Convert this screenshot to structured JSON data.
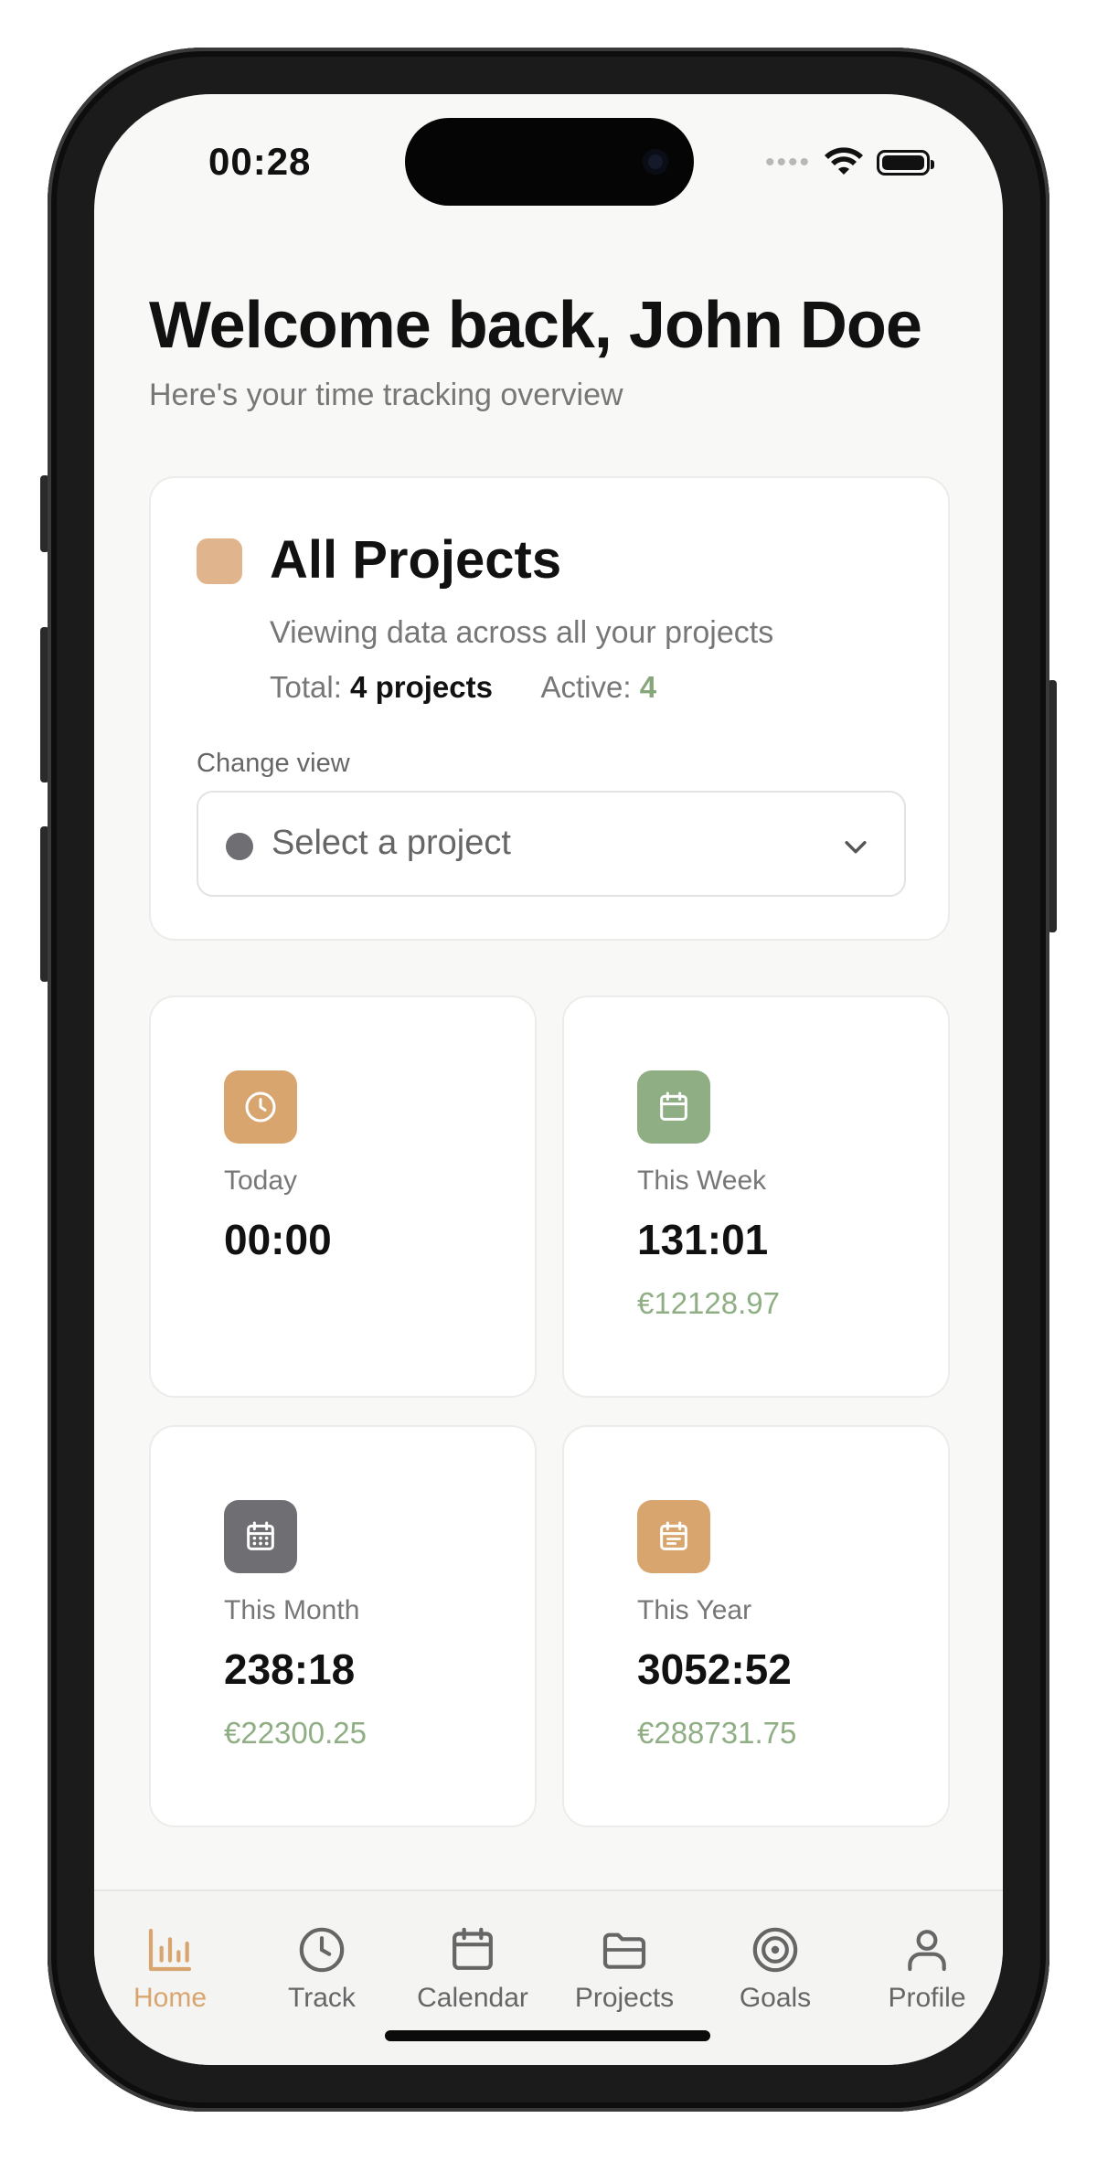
{
  "status_bar": {
    "time": "00:28",
    "signal": "•••• "
  },
  "header": {
    "greeting": "Welcome back, John Doe",
    "subtitle": "Here's your time tracking overview"
  },
  "project_card": {
    "title": "All Projects",
    "description": "Viewing data across all your projects",
    "total_label": "Total:",
    "total_value": "4 projects",
    "active_label": "Active:",
    "active_value": "4",
    "change_view_label": "Change view",
    "select_placeholder": "Select a project",
    "swatch_color": "#e0b58e"
  },
  "stats": {
    "today": {
      "label": "Today",
      "value": "00:00",
      "icon": "clock-icon",
      "color": "#d9a56f"
    },
    "week": {
      "label": "This Week",
      "value": "131:01",
      "amount": "€12128.97",
      "icon": "calendar-icon",
      "color": "#8fae84"
    },
    "month": {
      "label": "This Month",
      "value": "238:18",
      "amount": "€22300.25",
      "icon": "calendar-grid-icon",
      "color": "#6f6f73"
    },
    "year": {
      "label": "This Year",
      "value": "3052:52",
      "amount": "€288731.75",
      "icon": "calendar-list-icon",
      "color": "#d9a56f"
    }
  },
  "tabs": [
    {
      "label": "Home",
      "icon": "bar-chart-icon",
      "active": true
    },
    {
      "label": "Track",
      "icon": "clock-icon",
      "active": false
    },
    {
      "label": "Calendar",
      "icon": "calendar-icon",
      "active": false
    },
    {
      "label": "Projects",
      "icon": "folder-icon",
      "active": false
    },
    {
      "label": "Goals",
      "icon": "target-icon",
      "active": false
    },
    {
      "label": "Profile",
      "icon": "user-icon",
      "active": false
    }
  ],
  "colors": {
    "accent": "#d9a56f",
    "positive": "#8fae84",
    "background": "#f8f8f7"
  }
}
